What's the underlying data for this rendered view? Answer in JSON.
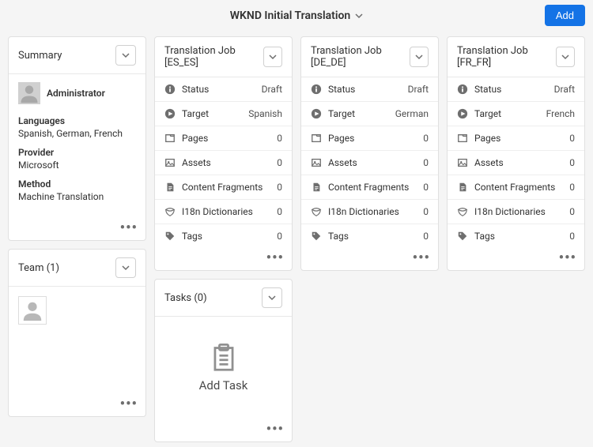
{
  "header": {
    "title": "WKND Initial Translation",
    "add_label": "Add"
  },
  "summary": {
    "title": "Summary",
    "admin": "Administrator",
    "languages_label": "Languages",
    "languages_value": "Spanish, German, French",
    "provider_label": "Provider",
    "provider_value": "Microsoft",
    "method_label": "Method",
    "method_value": "Machine Translation"
  },
  "team": {
    "title": "Team (1)"
  },
  "jobs": [
    {
      "title": "Translation Job [ES_ES]",
      "rows": [
        {
          "icon": "info",
          "label": "Status",
          "value": "Draft"
        },
        {
          "icon": "target",
          "label": "Target",
          "value": "Spanish"
        },
        {
          "icon": "pages",
          "label": "Pages",
          "value": "0"
        },
        {
          "icon": "assets",
          "label": "Assets",
          "value": "0"
        },
        {
          "icon": "cf",
          "label": "Content Fragments",
          "value": "0"
        },
        {
          "icon": "dict",
          "label": "I18n Dictionaries",
          "value": "0"
        },
        {
          "icon": "tag",
          "label": "Tags",
          "value": "0"
        }
      ]
    },
    {
      "title": "Translation Job [DE_DE]",
      "rows": [
        {
          "icon": "info",
          "label": "Status",
          "value": "Draft"
        },
        {
          "icon": "target",
          "label": "Target",
          "value": "German"
        },
        {
          "icon": "pages",
          "label": "Pages",
          "value": "0"
        },
        {
          "icon": "assets",
          "label": "Assets",
          "value": "0"
        },
        {
          "icon": "cf",
          "label": "Content Fragments",
          "value": "0"
        },
        {
          "icon": "dict",
          "label": "I18n Dictionaries",
          "value": "0"
        },
        {
          "icon": "tag",
          "label": "Tags",
          "value": "0"
        }
      ]
    },
    {
      "title": "Translation Job [FR_FR]",
      "rows": [
        {
          "icon": "info",
          "label": "Status",
          "value": "Draft"
        },
        {
          "icon": "target",
          "label": "Target",
          "value": "French"
        },
        {
          "icon": "pages",
          "label": "Pages",
          "value": "0"
        },
        {
          "icon": "assets",
          "label": "Assets",
          "value": "0"
        },
        {
          "icon": "cf",
          "label": "Content Fragments",
          "value": "0"
        },
        {
          "icon": "dict",
          "label": "I18n Dictionaries",
          "value": "0"
        },
        {
          "icon": "tag",
          "label": "Tags",
          "value": "0"
        }
      ]
    }
  ],
  "tasks": {
    "title": "Tasks (0)",
    "add_task_label": "Add Task"
  }
}
